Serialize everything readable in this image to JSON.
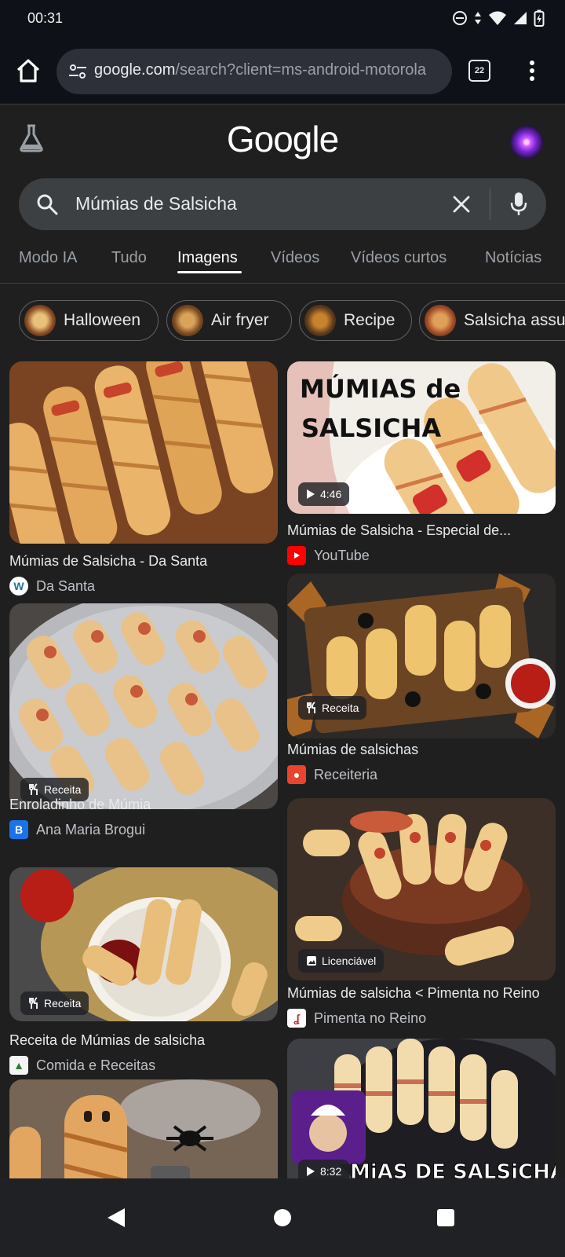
{
  "status": {
    "time": "00:31"
  },
  "browser": {
    "url_host": "google.com",
    "url_path": "/search?client=ms-android-motorola",
    "tab_count": "22"
  },
  "google": {
    "logo": "Google"
  },
  "search": {
    "query": "Múmias de Salsicha"
  },
  "tabs": [
    {
      "label": "Modo IA"
    },
    {
      "label": "Tudo"
    },
    {
      "label": "Imagens"
    },
    {
      "label": "Vídeos"
    },
    {
      "label": "Vídeos curtos"
    },
    {
      "label": "Notícias"
    }
  ],
  "active_tab": "Imagens",
  "chips": [
    {
      "label": "Halloween"
    },
    {
      "label": "Air fryer"
    },
    {
      "label": "Recipe"
    },
    {
      "label": "Salsicha assu"
    }
  ],
  "results": [
    {
      "title": "Múmias de Salsicha - Da Santa",
      "source": "Da Santa",
      "overlay_text": "",
      "badge": ""
    },
    {
      "title": "Múmias de Salsicha - Especial de...",
      "source": "YouTube",
      "overlay_text": "MÚMIAS de SALSICHA",
      "badge": "4:46"
    },
    {
      "title": "Enroladinho de Múmia",
      "source": "Ana Maria Brogui",
      "overlay_text": "",
      "badge": "Receita"
    },
    {
      "title": "Múmias de salsichas",
      "source": "Receiteria",
      "overlay_text": "",
      "badge": "Receita"
    },
    {
      "title": "Receita de Múmias de salsicha",
      "source": "Comida e Receitas",
      "overlay_text": "",
      "badge": "Receita"
    },
    {
      "title": "Múmias de salsicha < Pimenta no Reino",
      "source": "Pimenta no Reino",
      "overlay_text": "",
      "badge": "Licenciável"
    },
    {
      "title": "",
      "source": "",
      "overlay_text": "",
      "badge": ""
    },
    {
      "title": "",
      "source": "",
      "overlay_text": "MiAS DE SALSiCHA",
      "badge": "8:32"
    }
  ],
  "colors": {
    "background": "#1f1f1f",
    "status_bar": "#0e1118",
    "search_box": "#3c4043",
    "youtube_red": "#ff0000"
  }
}
